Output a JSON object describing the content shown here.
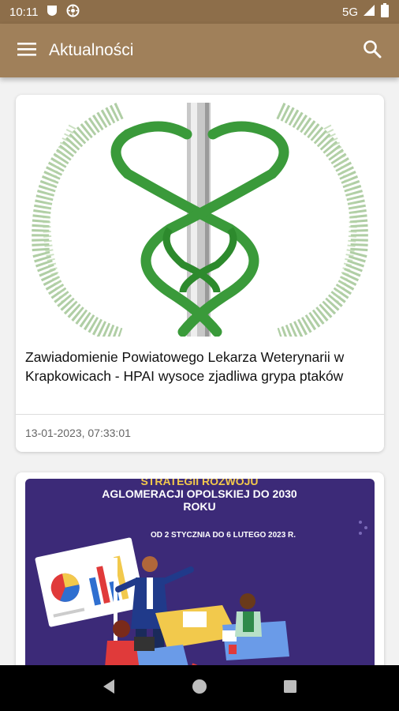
{
  "status_bar": {
    "time": "10:11",
    "network": "5G",
    "icons": [
      "shield-icon",
      "globe-icon",
      "signal-icon",
      "battery-icon"
    ]
  },
  "app_bar": {
    "title": "Aktualności",
    "menu_icon": "menu-icon",
    "search_icon": "search-icon"
  },
  "articles": [
    {
      "title": "Zawiadomienie Powiatowego Lekarza Weterynarii w Krapkowicach - HPAI wysoce zjadliwa grypa ptaków",
      "date": "13-01-2023, 07:33:01",
      "image": "veterinary-caduceus-logo"
    },
    {
      "image": "strategy-poster",
      "poster_heading_1": "STRATEGII ROZWOJU",
      "poster_heading_2": "AGLOMERACJI OPOLSKIEJ DO 2030",
      "poster_heading_3": "ROKU",
      "poster_dates": "OD 2 STYCZNIA DO 6 LUTEGO 2023 R."
    }
  ],
  "colors": {
    "app_bar": "#a0805a",
    "status_bar": "#8d6e4a",
    "poster_bg": "#3c2a78"
  },
  "nav_bar": {
    "icons": [
      "back-icon",
      "home-icon",
      "recents-icon"
    ]
  }
}
